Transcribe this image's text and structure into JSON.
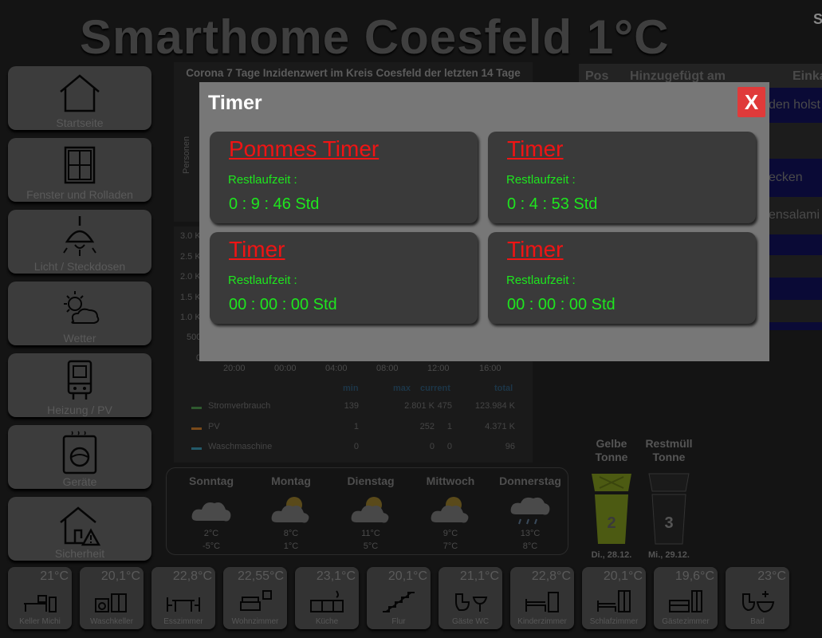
{
  "header": {
    "title": "Smarthome Coesfeld 1°C",
    "corner_text": "S"
  },
  "nav": [
    {
      "label": "Startseite",
      "icon": "house-icon"
    },
    {
      "label": "Fenster und Rolladen",
      "icon": "window-icon"
    },
    {
      "label": "Licht / Steckdosen",
      "icon": "lamp-icon"
    },
    {
      "label": "Wetter",
      "icon": "weather-icon"
    },
    {
      "label": "Heizung / PV",
      "icon": "boiler-icon"
    },
    {
      "label": "Geräte",
      "icon": "washing-machine-icon"
    },
    {
      "label": "Sicherheit",
      "icon": "house-alert-icon"
    }
  ],
  "corona": {
    "title": "Corona 7 Tage Inzidenzwert im Kreis Coesfeld der letzten 14 Tage",
    "ylabel": "Personen"
  },
  "power": {
    "y_ticks": [
      "3.0 K",
      "2.5 K",
      "2.0 K",
      "1.5 K",
      "1.0 K",
      "500",
      "0"
    ],
    "x_ticks": [
      "20:00",
      "00:00",
      "04:00",
      "08:00",
      "12:00",
      "16:00"
    ],
    "headers": {
      "min": "min",
      "max": "max",
      "current": "current",
      "total": "total"
    },
    "rows": [
      {
        "name": "Stromverbrauch",
        "min": "139",
        "max": "2.801 K",
        "current": "475",
        "total": "123.984 K",
        "color": "#2f5a2f"
      },
      {
        "name": "PV",
        "min": "1",
        "max": "252",
        "current": "1",
        "total": "4.371 K",
        "color": "#7a4a1a"
      },
      {
        "name": "Waschmaschine",
        "min": "0",
        "max": "0",
        "current": "0",
        "total": "96",
        "color": "#235a6a"
      }
    ]
  },
  "shopping": {
    "headers": {
      "pos": "Pos",
      "added": "Hinzugefügt am",
      "item": "Einka"
    },
    "rows": [
      "den holst",
      "ecken",
      "ensalami"
    ]
  },
  "bins": [
    {
      "title_line1": "Gelbe",
      "title_line2": "Tonne",
      "number": "2",
      "date": "Di., 28.12.",
      "color": "#4c5a12"
    },
    {
      "title_line1": "Restmüll",
      "title_line2": "Tonne",
      "number": "3",
      "date": "Mi., 29.12.",
      "color": "#181818"
    }
  ],
  "weather": [
    {
      "day": "Sonntag",
      "high": "2°C",
      "low": "-5°C",
      "icon": "cloudy-icon"
    },
    {
      "day": "Montag",
      "high": "8°C",
      "low": "1°C",
      "icon": "partly-cloudy-icon"
    },
    {
      "day": "Dienstag",
      "high": "11°C",
      "low": "5°C",
      "icon": "partly-cloudy-icon"
    },
    {
      "day": "Mittwoch",
      "high": "9°C",
      "low": "7°C",
      "icon": "partly-cloudy-icon"
    },
    {
      "day": "Donnerstag",
      "high": "13°C",
      "low": "8°C",
      "icon": "rain-icon"
    }
  ],
  "rooms": [
    {
      "name": "Keller Michi",
      "temp": "21°C"
    },
    {
      "name": "Waschkeller",
      "temp": "20,1°C"
    },
    {
      "name": "Esszimmer",
      "temp": "22,8°C"
    },
    {
      "name": "Wohnzimmer",
      "temp": "22,55°C"
    },
    {
      "name": "Küche",
      "temp": "23,1°C"
    },
    {
      "name": "Flur",
      "temp": "20,1°C"
    },
    {
      "name": "Gäste WC",
      "temp": "21,1°C"
    },
    {
      "name": "Kinderzimmer",
      "temp": "22,8°C"
    },
    {
      "name": "Schlafzimmer",
      "temp": "20,1°C"
    },
    {
      "name": "Gästezimmer",
      "temp": "19,6°C"
    },
    {
      "name": "Bad",
      "temp": "23°C"
    }
  ],
  "modal": {
    "title": "Timer",
    "close_label": "X",
    "timers": [
      {
        "name": "Pommes Timer",
        "label": "Restlaufzeit :",
        "value": "0 : 9 : 46 Std"
      },
      {
        "name": "Timer",
        "label": "Restlaufzeit :",
        "value": "0 : 4 : 53 Std"
      },
      {
        "name": "Timer",
        "label": "Restlaufzeit :",
        "value": "00 : 00 : 00 Std"
      },
      {
        "name": "Timer",
        "label": "Restlaufzeit :",
        "value": "00 : 00 : 00 Std"
      }
    ]
  }
}
